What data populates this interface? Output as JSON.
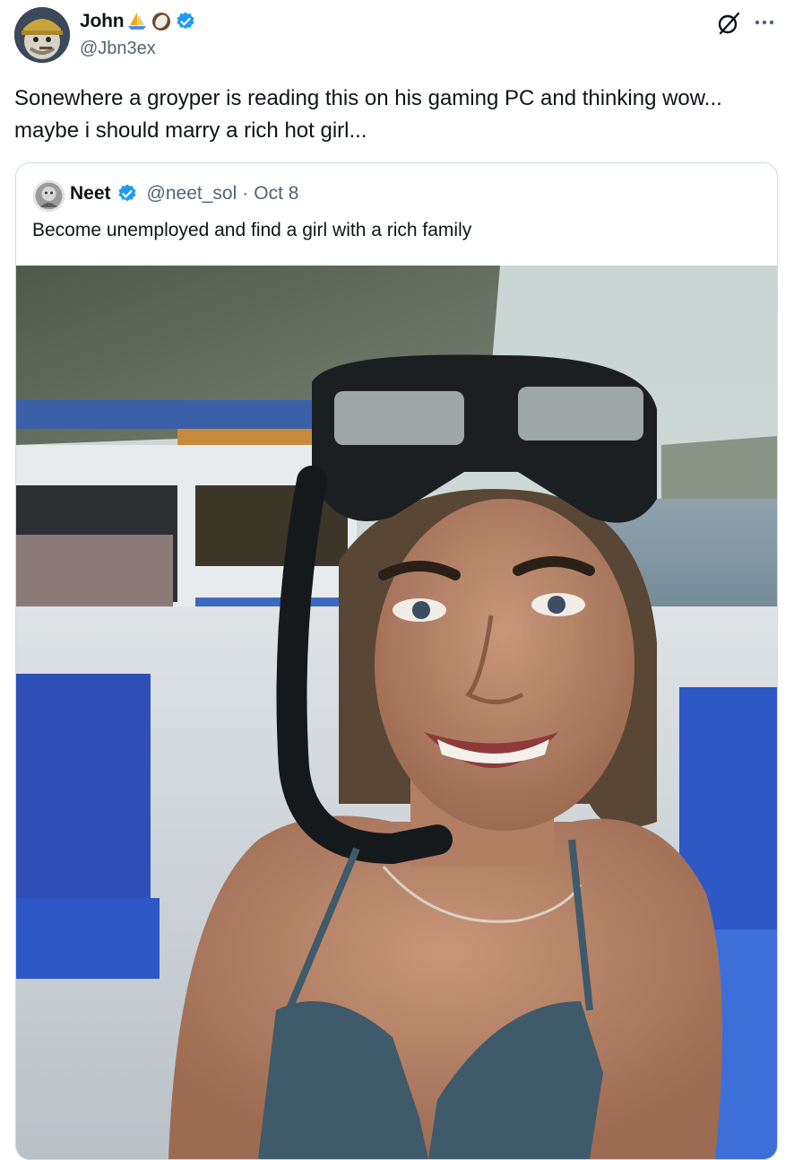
{
  "tweet": {
    "author_name": "John",
    "author_emojis": [
      "sailboat",
      "coconut"
    ],
    "author_handle": "@Jbn3ex",
    "verified": true,
    "text": "Sonewhere a groyper is reading this on his gaming PC and thinking wow... maybe i should marry a rich hot girl..."
  },
  "quote": {
    "author_name": "Neet",
    "author_handle": "@neet_sol",
    "separator": "·",
    "date": "Oct 8",
    "verified": true,
    "text": "Become unemployed and find a girl with a rich family"
  },
  "icons": {
    "grok": "grok-icon",
    "more": "more-icon",
    "verified": "verified-badge-icon"
  },
  "colors": {
    "verified_blue": "#1d9bf0",
    "secondary_text": "#536471",
    "border": "#cfd9de"
  }
}
